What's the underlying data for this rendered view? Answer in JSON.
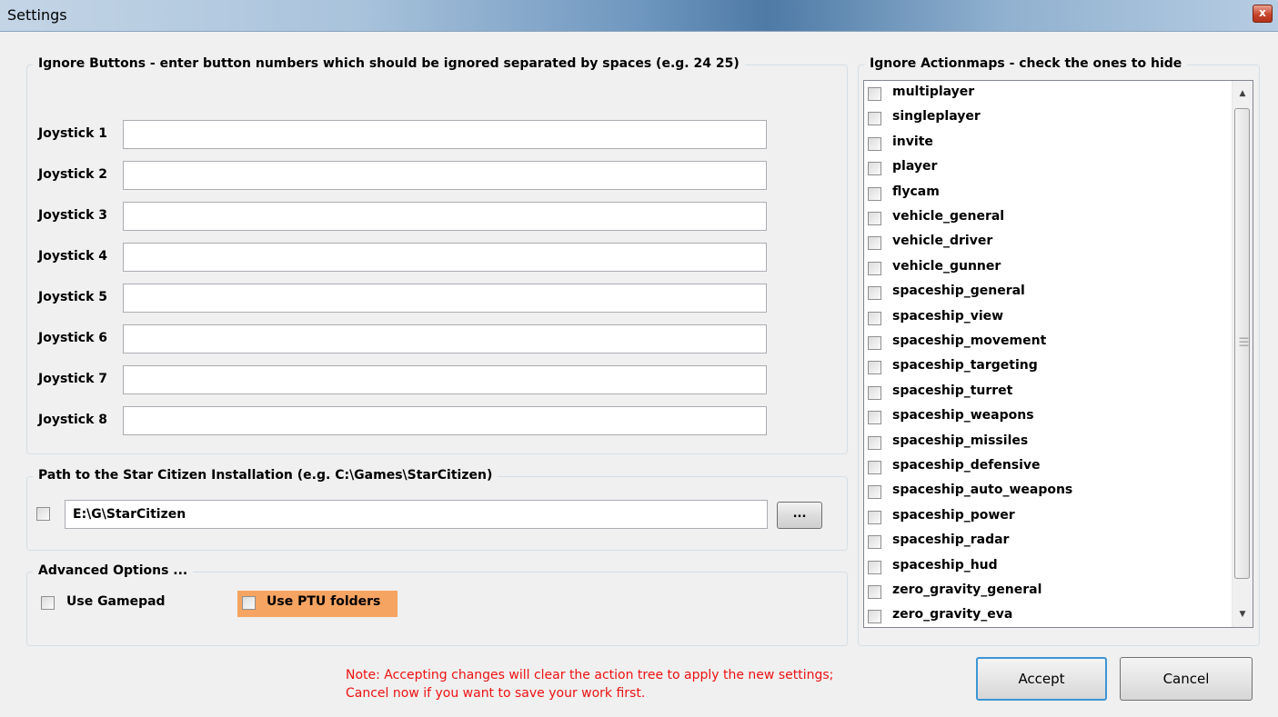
{
  "window": {
    "title": "Settings",
    "close_glyph": "x"
  },
  "ignore_buttons": {
    "legend": "Ignore Buttons - enter button numbers which should be ignored separated by spaces (e.g. 24 25)",
    "joysticks": [
      {
        "label": "Joystick 1",
        "value": ""
      },
      {
        "label": "Joystick 2",
        "value": ""
      },
      {
        "label": "Joystick 3",
        "value": ""
      },
      {
        "label": "Joystick 4",
        "value": ""
      },
      {
        "label": "Joystick 5",
        "value": ""
      },
      {
        "label": "Joystick 6",
        "value": ""
      },
      {
        "label": "Joystick 7",
        "value": ""
      },
      {
        "label": "Joystick 8",
        "value": ""
      }
    ]
  },
  "path": {
    "legend": "Path to the Star Citizen Installation (e.g. C:\\Games\\StarCitizen)",
    "enabled": false,
    "value": "E:\\G\\StarCitizen",
    "browse_label": "..."
  },
  "advanced": {
    "legend": "Advanced Options ...",
    "use_gamepad_label": "Use Gamepad",
    "use_gamepad_checked": false,
    "use_ptu_label": "Use PTU folders",
    "use_ptu_checked": false,
    "ptu_highlight_color": "#f6a462"
  },
  "actionmaps": {
    "legend": "Ignore Actionmaps - check the ones to hide",
    "items": [
      {
        "label": "multiplayer",
        "checked": false
      },
      {
        "label": "singleplayer",
        "checked": false
      },
      {
        "label": "invite",
        "checked": false
      },
      {
        "label": "player",
        "checked": false
      },
      {
        "label": "flycam",
        "checked": false
      },
      {
        "label": "vehicle_general",
        "checked": false
      },
      {
        "label": "vehicle_driver",
        "checked": false
      },
      {
        "label": "vehicle_gunner",
        "checked": false
      },
      {
        "label": "spaceship_general",
        "checked": false
      },
      {
        "label": "spaceship_view",
        "checked": false
      },
      {
        "label": "spaceship_movement",
        "checked": false
      },
      {
        "label": "spaceship_targeting",
        "checked": false
      },
      {
        "label": "spaceship_turret",
        "checked": false
      },
      {
        "label": "spaceship_weapons",
        "checked": false
      },
      {
        "label": "spaceship_missiles",
        "checked": false
      },
      {
        "label": "spaceship_defensive",
        "checked": false
      },
      {
        "label": "spaceship_auto_weapons",
        "checked": false
      },
      {
        "label": "spaceship_power",
        "checked": false
      },
      {
        "label": "spaceship_radar",
        "checked": false
      },
      {
        "label": "spaceship_hud",
        "checked": false
      },
      {
        "label": "zero_gravity_general",
        "checked": false
      },
      {
        "label": "zero_gravity_eva",
        "checked": false
      }
    ],
    "scroll_up_glyph": "▲",
    "scroll_down_glyph": "▼"
  },
  "note": {
    "line1": "Note: Accepting changes will clear the action tree to apply the new settings;",
    "line2": "Cancel now if you want to save your work first.",
    "color": "#ee1111"
  },
  "buttons": {
    "accept": "Accept",
    "cancel": "Cancel"
  }
}
